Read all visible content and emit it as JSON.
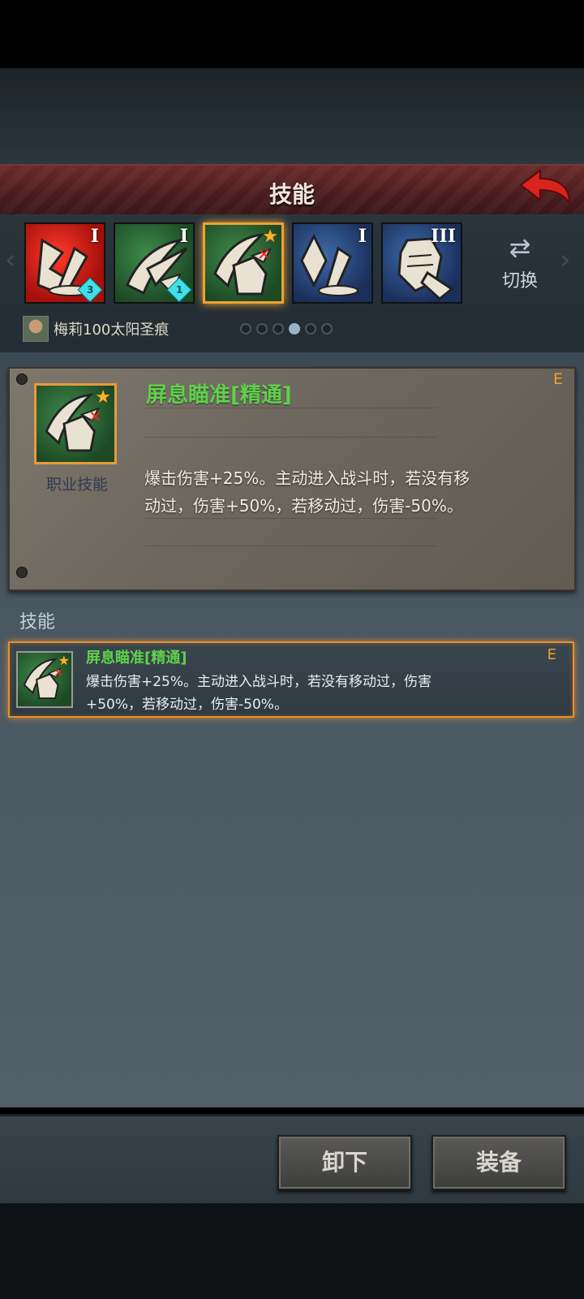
{
  "header": {
    "title": "技能",
    "back_icon": "back-arrow-icon"
  },
  "skill_slots": [
    {
      "id": "slot-1",
      "color": "red",
      "roman": "I",
      "gem": "3",
      "selected": false
    },
    {
      "id": "slot-2",
      "color": "green",
      "roman": "I",
      "gem": "1",
      "selected": false
    },
    {
      "id": "slot-3",
      "color": "green",
      "star": true,
      "selected": true
    },
    {
      "id": "slot-4",
      "color": "blue",
      "roman": "I",
      "selected": false
    },
    {
      "id": "slot-5",
      "color": "blue",
      "roman": "III",
      "selected": false
    }
  ],
  "switch_button": {
    "label": "切换",
    "icon": "swap-arrows-icon"
  },
  "hero": {
    "name": "梅莉100太阳圣痕"
  },
  "page_dots": {
    "count": 6,
    "active_index": 3
  },
  "detail": {
    "name": "屏息瞄准[精通]",
    "grade": "E",
    "type_label": "职业技能",
    "description_lines": [
      "爆击伤害+25%。主动进入战斗时，若没有移",
      "动过，伤害+50%，若移动过，伤害-50%。"
    ]
  },
  "skills_section": {
    "label": "技能",
    "items": [
      {
        "name": "屏息瞄准[精通]",
        "grade": "E",
        "description_lines": [
          "爆击伤害+25%。主动进入战斗时，若没有移动过，伤害",
          "+50%，若移动过，伤害-50%。"
        ]
      }
    ]
  },
  "buttons": {
    "unequip": "卸下",
    "equip": "装备"
  }
}
